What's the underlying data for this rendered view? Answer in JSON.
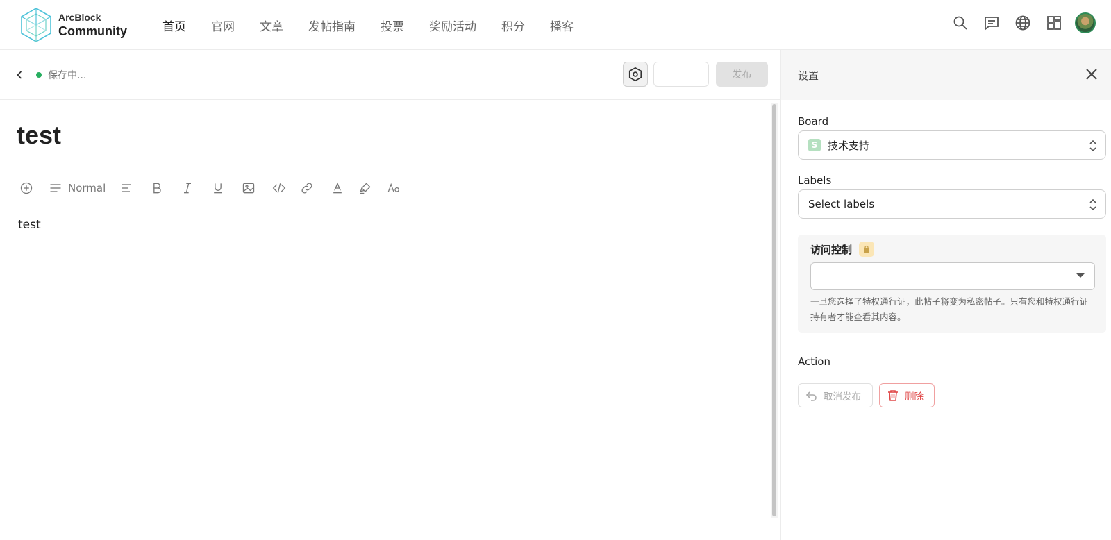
{
  "header": {
    "logo": {
      "top": "ArcBlock",
      "bottom": "Community"
    },
    "nav": [
      "首页",
      "官网",
      "文章",
      "发帖指南",
      "投票",
      "奖励活动",
      "积分",
      "播客"
    ],
    "active_nav": "首页",
    "icons": [
      "search-icon",
      "chat-icon",
      "globe-icon",
      "apps-grid-icon"
    ]
  },
  "subbar": {
    "status": "保存中...",
    "publish_label": "发布"
  },
  "editor": {
    "title": "test",
    "format_style": "Normal",
    "body": "test"
  },
  "settings": {
    "title": "设置",
    "board": {
      "label": "Board",
      "badge": "S",
      "value": "技术支持"
    },
    "labels": {
      "label": "Labels",
      "placeholder": "Select labels"
    },
    "access": {
      "title": "访问控制",
      "value": "",
      "help": "一旦您选择了特权通行证，此帖子将变为私密帖子。只有您和特权通行证持有者才能查看其内容。"
    },
    "action": {
      "label": "Action",
      "unpublish": "取消发布",
      "delete": "删除"
    }
  },
  "colors": {
    "status_dot": "#27ae60",
    "delete": "#e04848",
    "board_badge": "#b5e0c0"
  }
}
